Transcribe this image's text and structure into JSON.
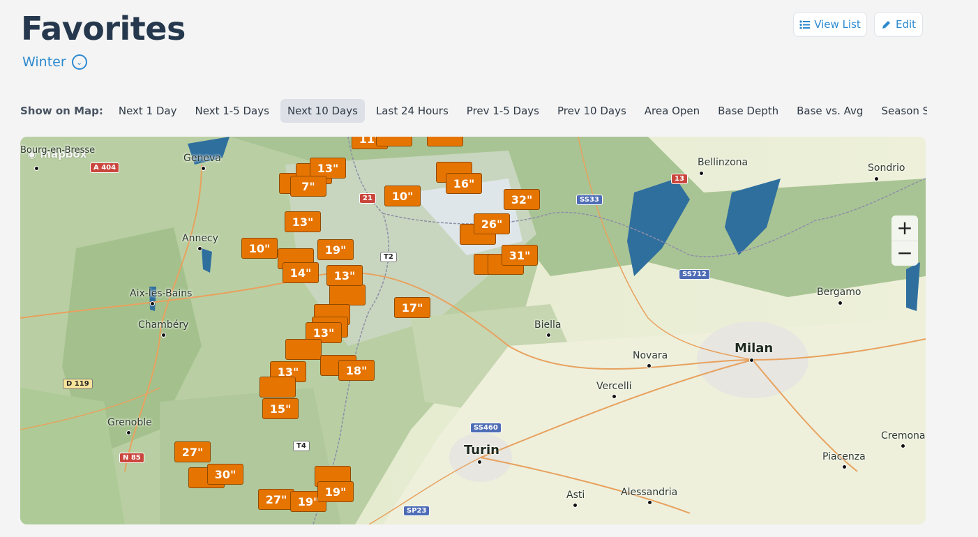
{
  "page": {
    "title": "Favorites",
    "collection": "Winter",
    "view_list_label": "View List",
    "edit_label": "Edit"
  },
  "show_on_map": {
    "label": "Show on Map:",
    "options": [
      "Next 1 Day",
      "Next 1-5 Days",
      "Next 10 Days",
      "Last 24 Hours",
      "Prev 1-5 Days",
      "Prev 10 Days",
      "Area Open",
      "Base Depth",
      "Base vs. Avg",
      "Season Snowfa"
    ],
    "active": "Next 10 Days"
  },
  "map": {
    "attribution": "mapbox",
    "cities": [
      {
        "name": "Geneva",
        "big": false
      },
      {
        "name": "Bourg-en-Bresse",
        "big": false
      },
      {
        "name": "Annecy",
        "big": false
      },
      {
        "name": "Aix-les-Bains",
        "big": false
      },
      {
        "name": "Chambéry",
        "big": false
      },
      {
        "name": "Grenoble",
        "big": false
      },
      {
        "name": "Bellinzona",
        "big": false
      },
      {
        "name": "Sondrio",
        "big": false
      },
      {
        "name": "Bergamo",
        "big": false
      },
      {
        "name": "Biella",
        "big": false
      },
      {
        "name": "Novara",
        "big": false
      },
      {
        "name": "Vercelli",
        "big": false
      },
      {
        "name": "Milan",
        "big": true
      },
      {
        "name": "Turin",
        "big": true
      },
      {
        "name": "Asti",
        "big": false
      },
      {
        "name": "Alessandria",
        "big": false
      },
      {
        "name": "Piacenza",
        "big": false
      },
      {
        "name": "Cremona",
        "big": false
      }
    ],
    "roads": [
      "A 404",
      "21",
      "T2",
      "SS33",
      "13",
      "SS712",
      "D 119",
      "SS460",
      "T4",
      "N 85",
      "SP23"
    ],
    "snow_markers": [
      "11\"",
      "13\"",
      "7\"",
      "16\"",
      "10\"",
      "32\"",
      "13\"",
      "26\"",
      "10\"",
      "19\"",
      "31\"",
      "14\"",
      "13\"",
      "17\"",
      "13\"",
      "18\"",
      "13\"",
      "15\"",
      "27\"",
      "30\"",
      "27\"",
      "19\"",
      "19\""
    ],
    "zoom_in": "+",
    "zoom_out": "−"
  },
  "colors": {
    "accent": "#2d8ad0",
    "marker": "#e67400",
    "title": "#26384d"
  }
}
